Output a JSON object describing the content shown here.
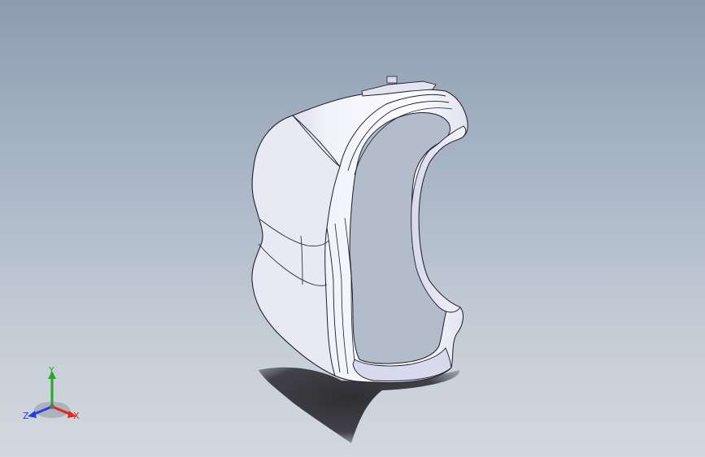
{
  "viewport": {
    "background_top": "#8d9cb0",
    "background_bottom": "#d3d8de",
    "model_color": "#ececf6",
    "edge_color": "#1e1e28",
    "shadow_color": "#2e2e33"
  },
  "triad": {
    "x_label": "X",
    "y_label": "Y",
    "z_label": "Z",
    "x_color": "#e0281e",
    "y_color": "#2aa62a",
    "z_color": "#2a3ee0"
  }
}
